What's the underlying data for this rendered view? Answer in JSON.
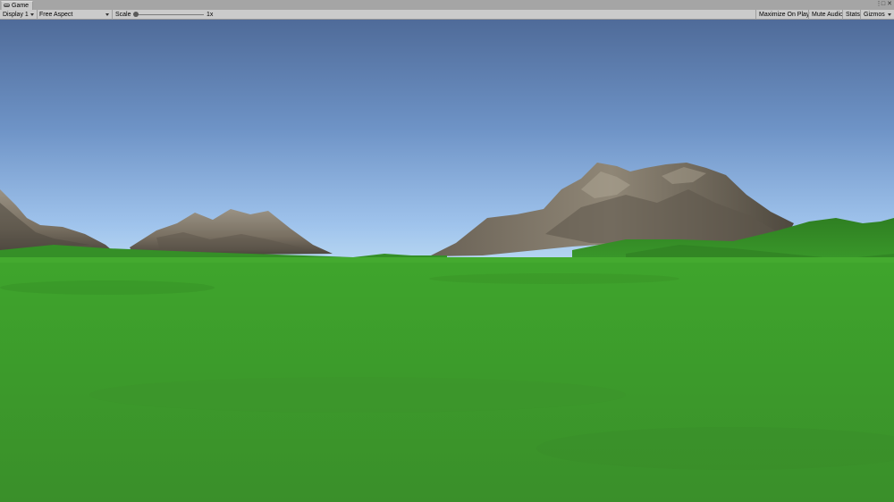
{
  "tab": {
    "label": "Game",
    "icon": "gamepad-icon"
  },
  "window_controls": {
    "more": "⋮",
    "maximize": "□",
    "close": "✕"
  },
  "toolbar": {
    "display": "Display 1",
    "aspect": "Free Aspect",
    "scale_label": "Scale",
    "scale_value": "1x",
    "maximize_on_play": "Maximize On Play",
    "mute_audio": "Mute Audio",
    "stats": "Stats",
    "gizmos": "Gizmos"
  },
  "colors": {
    "sky_top": "#4e6b9a",
    "sky_horizon": "#a9cbee",
    "grass": "#3e9a2c",
    "mountain_light": "#8a8173",
    "mountain_dark": "#4b453c"
  }
}
